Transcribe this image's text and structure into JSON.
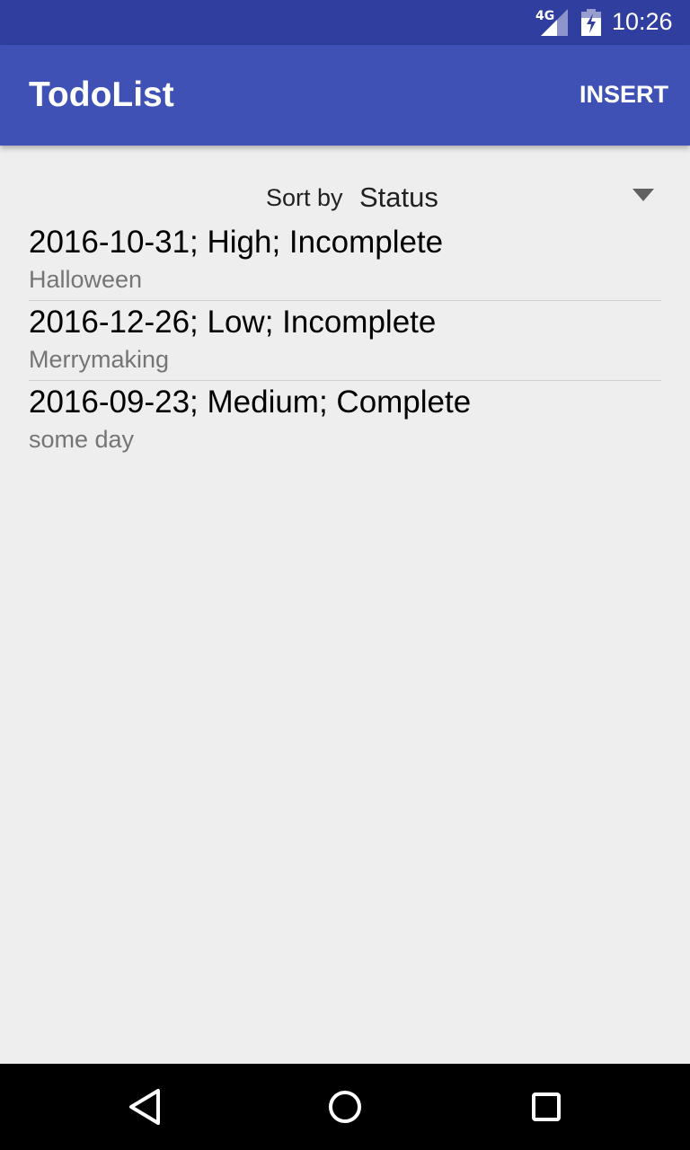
{
  "status_bar": {
    "network": "4G",
    "time": "10:26"
  },
  "app_bar": {
    "title": "TodoList",
    "insert_label": "INSERT"
  },
  "sort": {
    "label": "Sort by",
    "selected": "Status"
  },
  "todos": [
    {
      "summary": "2016-10-31; High; Incomplete",
      "description": "Halloween"
    },
    {
      "summary": "2016-12-26; Low; Incomplete",
      "description": "Merrymaking"
    },
    {
      "summary": "2016-09-23; Medium; Complete",
      "description": "some day"
    }
  ],
  "nav": {
    "icons": [
      "back-icon",
      "home-icon",
      "recents-icon"
    ]
  },
  "colors": {
    "status_bar": "#303f9f",
    "app_bar": "#3f51b5",
    "background": "#eeeeee",
    "secondary_text": "#757575"
  }
}
